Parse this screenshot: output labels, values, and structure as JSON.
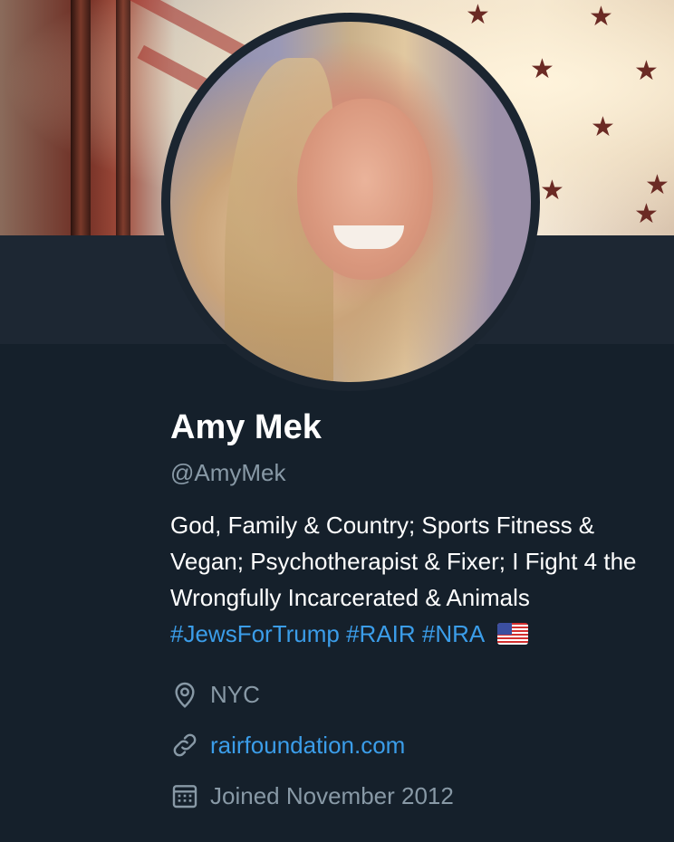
{
  "profile": {
    "name": "Amy Mek",
    "handle": "@AmyMek",
    "bio_text": "God, Family & Country; Sports Fitness & Vegan; Psychotherapist & Fixer; I Fight 4 the Wrongfully Incarcerated & Animals",
    "hashtags": [
      "#JewsForTrump",
      "#RAIR",
      "#NRA"
    ],
    "flag_emoji": "us-flag-emoji",
    "location": "NYC",
    "website": "rairfoundation.com",
    "joined": "Joined November 2012"
  },
  "icons": {
    "location": "location-pin-icon",
    "link": "link-icon",
    "calendar": "calendar-icon"
  },
  "colors": {
    "background": "#15202b",
    "accent": "#3b9de9",
    "muted": "#8899a6"
  }
}
